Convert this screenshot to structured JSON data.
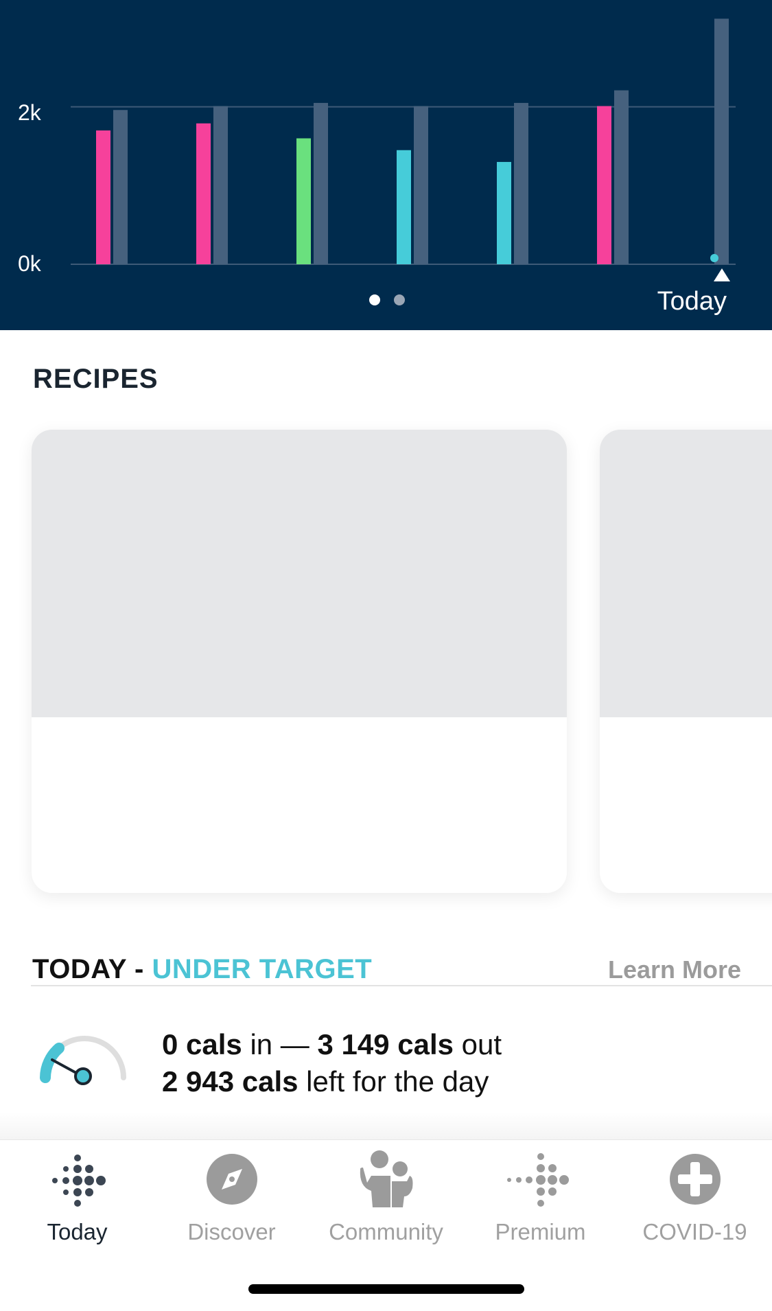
{
  "chart": {
    "tick_top": "2k",
    "tick_bottom": "0k",
    "today_label": "Today",
    "page_dots": 2,
    "active_page": 1,
    "colors": {
      "background": "#002b4d",
      "target_bar": "#46617e",
      "over": "#f6419b",
      "near": "#6ae07e",
      "under": "#46ccd9"
    }
  },
  "chart_data": {
    "type": "bar",
    "ylim": [
      0,
      3000
    ],
    "ticks": [
      {
        "value": 0,
        "label": "0k"
      },
      {
        "value": 2000,
        "label": "2k"
      }
    ],
    "series": [
      {
        "values": [
          1700,
          1790,
          1600,
          1450,
          1300,
          2010,
          70
        ],
        "status": [
          "over",
          "over",
          "near",
          "under",
          "under",
          "over",
          "under"
        ]
      },
      {
        "values": [
          1960,
          2010,
          2050,
          2010,
          2050,
          2210,
          3120
        ]
      }
    ]
  },
  "recipes": {
    "title": "RECIPES"
  },
  "summary": {
    "heading": "TODAY - ",
    "status": "UNDER TARGET",
    "learn_more": "Learn More",
    "cals_in": "0 cals",
    "in_word": " in — ",
    "cals_out": "3 149 cals",
    "out_word": " out",
    "cals_left": "2 943 cals",
    "left_text": " left for the day",
    "gauge_icon": "calorie-gauge-icon"
  },
  "tabs": [
    {
      "label": "Today",
      "icon": "fitbit-logo-icon",
      "active": true
    },
    {
      "label": "Discover",
      "icon": "compass-icon",
      "active": false
    },
    {
      "label": "Community",
      "icon": "community-people-icon",
      "active": false
    },
    {
      "label": "Premium",
      "icon": "premium-logo-icon",
      "active": false
    },
    {
      "label": "COVID-19",
      "icon": "medical-cross-icon",
      "active": false
    }
  ]
}
